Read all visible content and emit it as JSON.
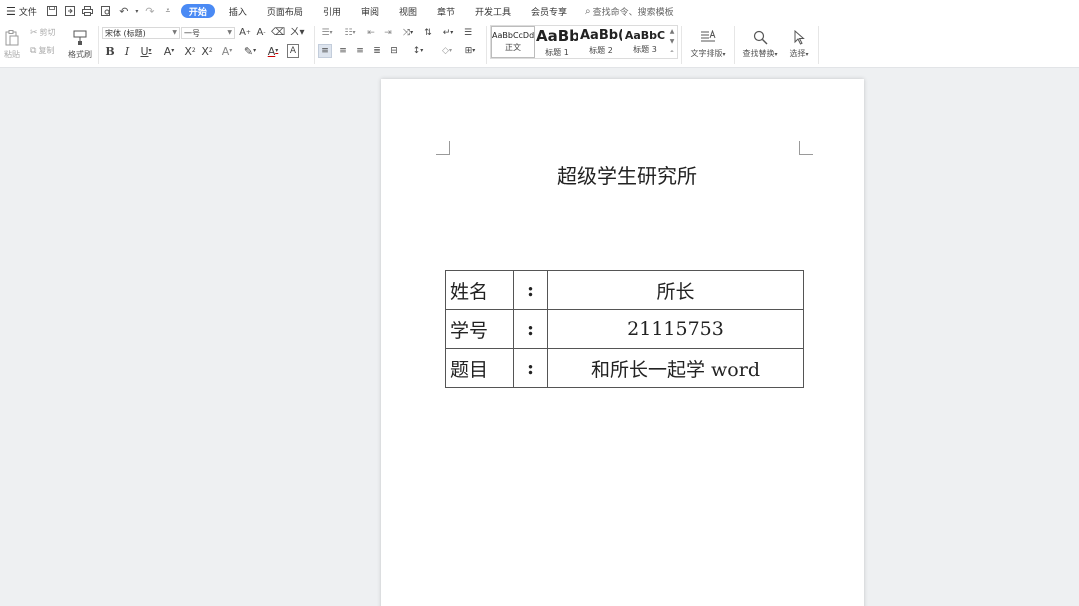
{
  "menubar": {
    "file_label": "文件",
    "tabs": [
      "开始",
      "插入",
      "页面布局",
      "引用",
      "审阅",
      "视图",
      "章节",
      "开发工具",
      "会员专享"
    ],
    "active_tab": "开始",
    "search_placeholder": "查找命令、搜索模板"
  },
  "ribbon": {
    "paste_label": "粘贴",
    "cut_label": "剪切",
    "copy_label": "复制",
    "format_painter_label": "格式刷",
    "font_name": "宋体 (标题)",
    "font_size": "一号",
    "styles": [
      {
        "sample": "AaBbCcDd",
        "name": "正文"
      },
      {
        "sample": "AaBb",
        "name": "标题 1"
      },
      {
        "sample": "AaBb(",
        "name": "标题 2"
      },
      {
        "sample": "AaBbC",
        "name": "标题 3"
      }
    ],
    "text_layout_label": "文字排版",
    "find_replace_label": "查找替换",
    "select_label": "选择"
  },
  "document": {
    "title": "超级学生研究所",
    "rows": [
      {
        "label": "姓名",
        "colon": ":",
        "value": "所长"
      },
      {
        "label": "学号",
        "colon": ":",
        "value": "21115753"
      },
      {
        "label": "题目",
        "colon": ":",
        "value": "和所长一起学 word"
      }
    ]
  },
  "colors": {
    "accent": "#4a8af4",
    "background": "#eef0f2",
    "page": "#ffffff"
  }
}
